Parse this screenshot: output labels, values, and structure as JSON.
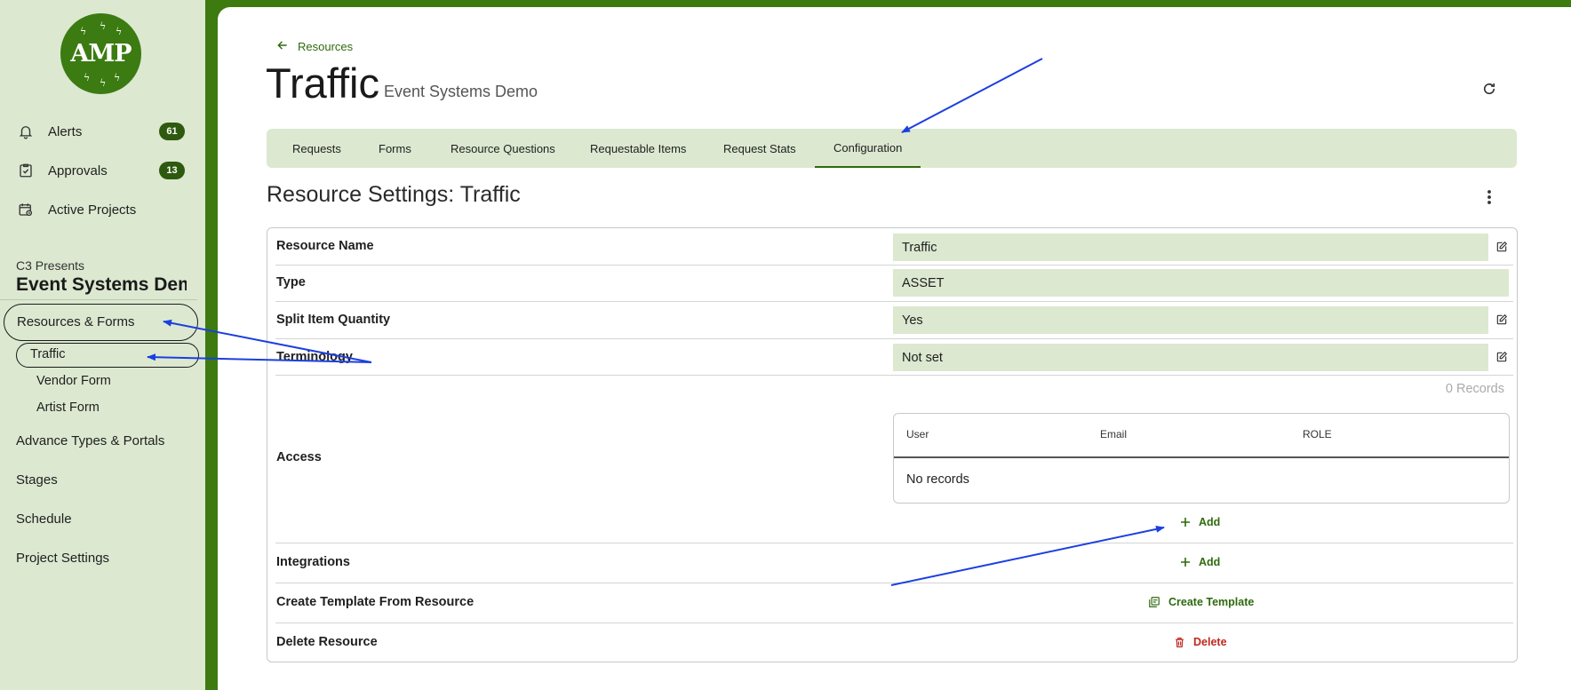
{
  "sidebar": {
    "logo_text": "AMP",
    "nav": [
      {
        "label": "Alerts",
        "icon": "bell-icon",
        "badge": "61"
      },
      {
        "label": "Approvals",
        "icon": "clipboard-check-icon",
        "badge": "13"
      },
      {
        "label": "Active Projects",
        "icon": "calendar-active-icon",
        "badge": ""
      }
    ],
    "org": "C3 Presents",
    "project": "Event Systems Demo",
    "menu": {
      "resources_forms": "Resources & Forms",
      "sub_items": [
        "Traffic",
        "Vendor Form",
        "Artist Form"
      ],
      "advance_types": "Advance Types & Portals",
      "stages": "Stages",
      "schedule": "Schedule",
      "project_settings": "Project Settings"
    }
  },
  "header": {
    "back_label": "Resources",
    "title": "Traffic",
    "subtitle": "Event Systems Demo"
  },
  "tabs": [
    {
      "label": "Requests",
      "active": false
    },
    {
      "label": "Forms",
      "active": false
    },
    {
      "label": "Resource Questions",
      "active": false
    },
    {
      "label": "Requestable Items",
      "active": false
    },
    {
      "label": "Request Stats",
      "active": false
    },
    {
      "label": "Configuration",
      "active": true
    }
  ],
  "settings": {
    "title": "Resource Settings: Traffic",
    "rows": {
      "resource_name": {
        "label": "Resource Name",
        "value": "Traffic"
      },
      "type": {
        "label": "Type",
        "value": "ASSET"
      },
      "split": {
        "label": "Split Item Quantity",
        "value": "Yes"
      },
      "terminology": {
        "label": "Terminology",
        "value": "Not set"
      }
    },
    "access": {
      "label": "Access",
      "records": "0 Records",
      "columns": [
        "User",
        "Email",
        "ROLE"
      ],
      "empty": "No records",
      "add_label": "Add"
    },
    "integrations": {
      "label": "Integrations",
      "add_label": "Add"
    },
    "template": {
      "label": "Create Template From Resource",
      "action": "Create Template"
    },
    "delete": {
      "label": "Delete Resource",
      "action": "Delete"
    }
  },
  "colors": {
    "brand_green": "#3d7a0f",
    "sidebar_bg": "#dce8d0",
    "action_green": "#2f6a0d",
    "danger_red": "#c0281e",
    "annotation_blue": "#1c3fe0"
  }
}
